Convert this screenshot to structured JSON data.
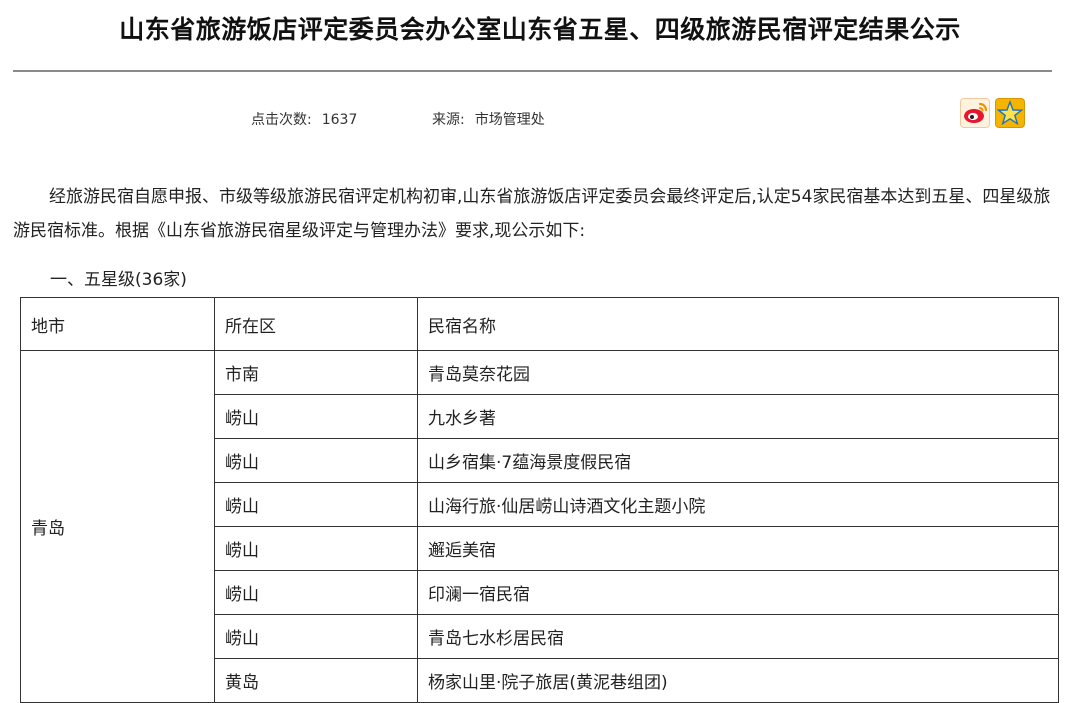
{
  "title": "山东省旅游饭店评定委员会办公室山东省五星、四级旅游民宿评定结果公示",
  "meta": {
    "clicks_label": "点击次数:",
    "clicks_value": "1637",
    "source_label": "来源:",
    "source_value": "市场管理处"
  },
  "share": {
    "weibo_icon": "weibo-icon",
    "qzone_icon": "qzone-star-icon",
    "colors": {
      "weibo": "#e6162d",
      "qzone": "#f5b400"
    }
  },
  "intro": "经旅游民宿自愿申报、市级等级旅游民宿评定机构初审,山东省旅游饭店评定委员会最终评定后,认定54家民宿基本达到五星、四星级旅游民宿标准。根据《山东省旅游民宿星级评定与管理办法》要求,现公示如下:",
  "section_heading": "一、五星级(36家)",
  "table": {
    "headers": [
      "地市",
      "所在区",
      "民宿名称"
    ],
    "city": "青岛",
    "rows": [
      {
        "district": "市南",
        "name": "青岛莫奈花园"
      },
      {
        "district": "崂山",
        "name": "九水乡著"
      },
      {
        "district": "崂山",
        "name": "山乡宿集·7蕴海景度假民宿"
      },
      {
        "district": "崂山",
        "name": "山海行旅·仙居崂山诗酒文化主题小院"
      },
      {
        "district": "崂山",
        "name": "邂逅美宿"
      },
      {
        "district": "崂山",
        "name": "印澜一宿民宿"
      },
      {
        "district": "崂山",
        "name": "青岛七水杉居民宿"
      },
      {
        "district": "黄岛",
        "name": "杨家山里·院子旅居(黄泥巷组团)"
      }
    ]
  }
}
